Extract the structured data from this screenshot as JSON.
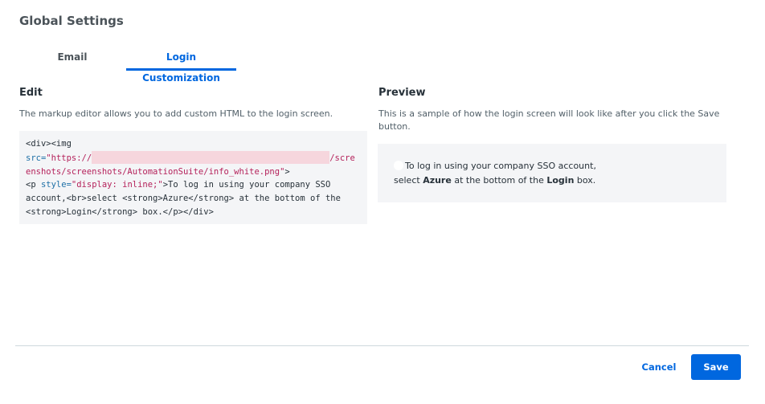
{
  "page": {
    "title": "Global Settings"
  },
  "tabs": [
    {
      "label": "Email",
      "active": false
    },
    {
      "label": "Login Customization",
      "active": true
    }
  ],
  "edit": {
    "title": "Edit",
    "description": "The markup editor allows you to add custom HTML to the login screen.",
    "code": {
      "l1": "<div><img",
      "l2_attr": "src=",
      "l2_str_start": "\"https://",
      "l2_str_end": "/scre",
      "l3_str": "enshots/screenshots/AutomationSuite/info_white.png\"",
      "l3_tag": ">",
      "l4_tag_open": "<p ",
      "l4_attr": "style=",
      "l4_str": "\"display: inline;\"",
      "l4_text": ">To log in using your company SSO",
      "l5": "account,<br>select <strong>Azure</strong> at the bottom of the",
      "l6": "<strong>Login</strong> box.</p></div>"
    }
  },
  "preview": {
    "title": "Preview",
    "description": "This is a sample of how the login screen will look like after you click the Save button.",
    "line1": "To log in using your company SSO account,",
    "line2_pre": "select ",
    "line2_bold1": "Azure",
    "line2_mid": " at the bottom of the ",
    "line2_bold2": "Login",
    "line2_post": " box."
  },
  "footer": {
    "cancel_label": "Cancel",
    "save_label": "Save"
  },
  "colors": {
    "accent": "#0067df",
    "editor_bg": "#f4f5f7",
    "redaction": "#f6d6dd"
  }
}
